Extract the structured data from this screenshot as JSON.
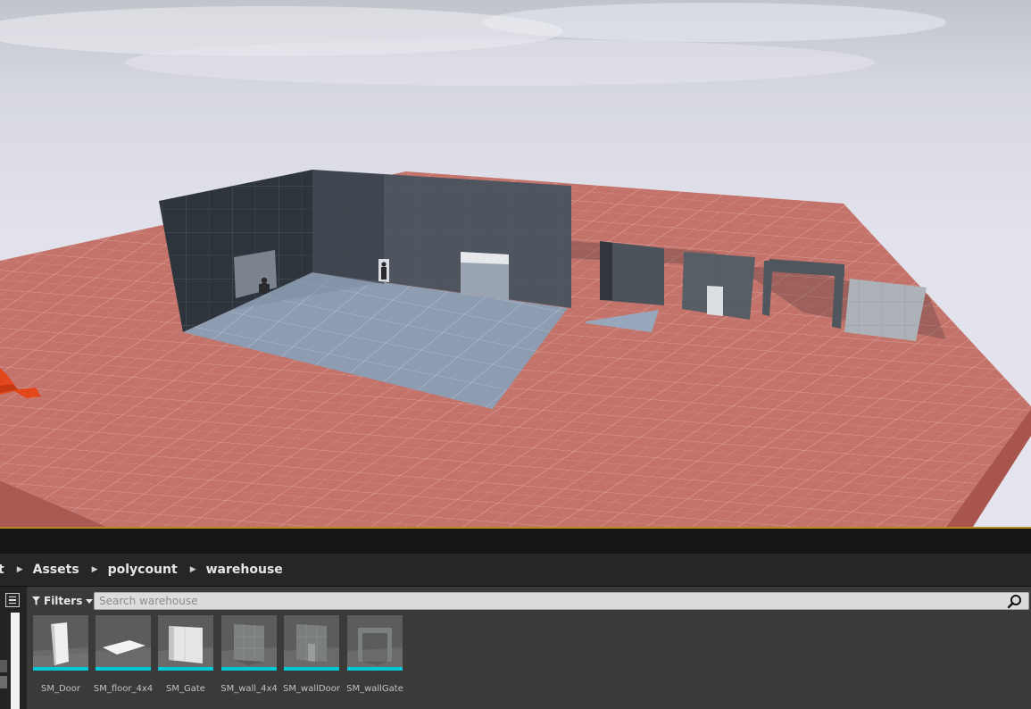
{
  "breadcrumb": {
    "items": [
      {
        "label": "t"
      },
      {
        "label": "Assets"
      },
      {
        "label": "polycount"
      },
      {
        "label": "warehouse"
      }
    ]
  },
  "toolbar": {
    "filters_label": "Filters",
    "search_placeholder": "Search warehouse"
  },
  "assets": [
    {
      "name": "SM_Door",
      "thumb": "door",
      "type_color": "#00c8d4"
    },
    {
      "name": "SM_floor_4x4",
      "thumb": "floor",
      "type_color": "#00c8d4"
    },
    {
      "name": "SM_Gate",
      "thumb": "gate",
      "type_color": "#00c8d4"
    },
    {
      "name": "SM_wall_4x4",
      "thumb": "wall",
      "type_color": "#00c8d4"
    },
    {
      "name": "SM_wallDoor",
      "thumb": "walldoor",
      "type_color": "#00c8d4"
    },
    {
      "name": "SM_wallGate",
      "thumb": "wallgate",
      "type_color": "#00c8d4"
    }
  ],
  "colors": {
    "viewport_border": "#b8891e",
    "floor": "#c4736b",
    "asset_type_bar": "#00c8d4"
  }
}
